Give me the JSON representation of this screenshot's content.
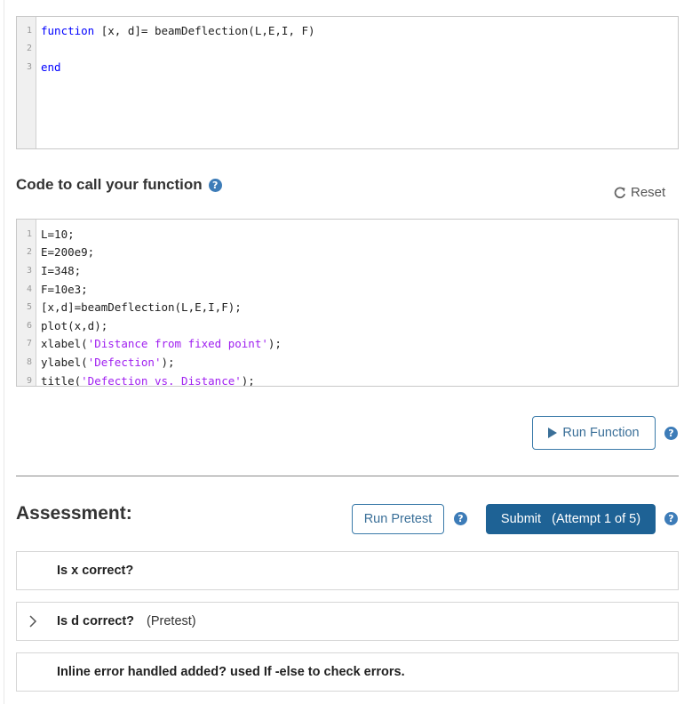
{
  "function_editor": {
    "lines": [
      {
        "n": "1",
        "parts": [
          {
            "t": "function",
            "c": "kw"
          },
          {
            "t": " [x, d]= beamDeflection(L,E,I, F)",
            "c": ""
          }
        ]
      },
      {
        "n": "2",
        "parts": []
      },
      {
        "n": "3",
        "parts": [
          {
            "t": "end",
            "c": "kw"
          }
        ]
      }
    ]
  },
  "call_section": {
    "title": "Code to call your function",
    "help_symbol": "?",
    "reset_label": "Reset"
  },
  "call_editor": {
    "lines": [
      {
        "n": "1",
        "parts": [
          {
            "t": "L=10;",
            "c": ""
          }
        ]
      },
      {
        "n": "2",
        "parts": [
          {
            "t": "E=200e9;",
            "c": ""
          }
        ]
      },
      {
        "n": "3",
        "parts": [
          {
            "t": "I=348;",
            "c": ""
          }
        ]
      },
      {
        "n": "4",
        "parts": [
          {
            "t": "F=10e3;",
            "c": ""
          }
        ]
      },
      {
        "n": "5",
        "parts": [
          {
            "t": "[x,d]=beamDeflection(L,E,I,F);",
            "c": ""
          }
        ]
      },
      {
        "n": "6",
        "parts": [
          {
            "t": "plot(x,d);",
            "c": ""
          }
        ]
      },
      {
        "n": "7",
        "parts": [
          {
            "t": "xlabel(",
            "c": ""
          },
          {
            "t": "'Distance from fixed point'",
            "c": "str"
          },
          {
            "t": ");",
            "c": ""
          }
        ]
      },
      {
        "n": "8",
        "parts": [
          {
            "t": "ylabel(",
            "c": ""
          },
          {
            "t": "'Defection'",
            "c": "str"
          },
          {
            "t": ");",
            "c": ""
          }
        ]
      },
      {
        "n": "9",
        "parts": [
          {
            "t": "title(",
            "c": ""
          },
          {
            "t": "'Defection vs. Distance'",
            "c": "str"
          },
          {
            "t": ");",
            "c": ""
          }
        ]
      }
    ]
  },
  "run_function_label": "Run Function",
  "assessment": {
    "title": "Assessment:",
    "run_pretest_label": "Run Pretest",
    "submit_label": "Submit   (Attempt 1 of 5)",
    "tests": [
      {
        "title": "Is x correct?",
        "tag": ""
      },
      {
        "title": "Is d correct?",
        "tag": "(Pretest)"
      },
      {
        "title": "Inline error handled added? used If -else to check errors.",
        "tag": ""
      }
    ]
  },
  "colors": {
    "keyword": "#0000ff",
    "string": "#a020f0",
    "primary_button": "#1e6295",
    "help_icon": "#3d7cb8"
  }
}
